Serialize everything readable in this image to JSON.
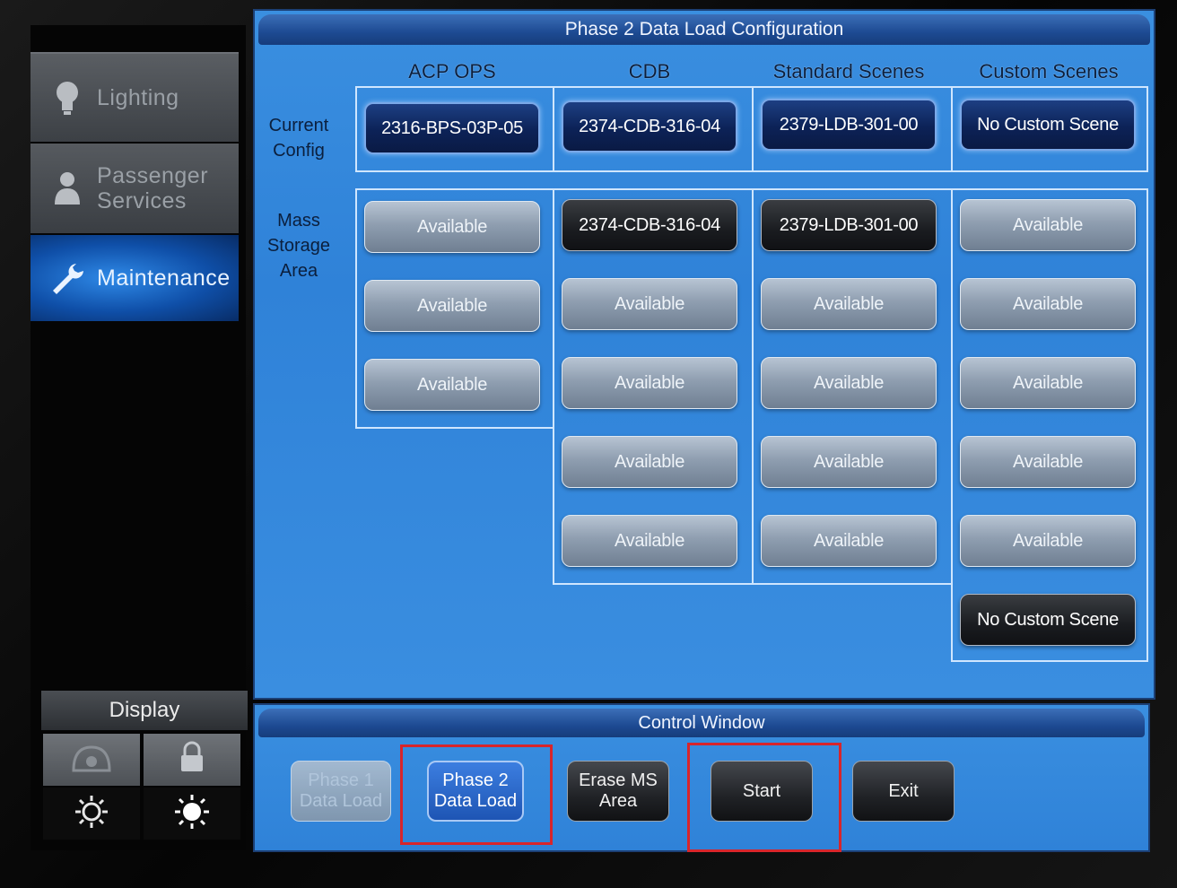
{
  "sidebar": {
    "items": [
      {
        "label": "Lighting"
      },
      {
        "label": "Passenger Services"
      },
      {
        "label": "Maintenance"
      }
    ],
    "display_label": "Display"
  },
  "main": {
    "title": "Phase 2 Data Load Configuration",
    "columns": [
      "ACP OPS",
      "CDB",
      "Standard Scenes",
      "Custom Scenes"
    ],
    "row_labels": {
      "current_config": "Current Config",
      "mass_storage": "Mass Storage Area"
    },
    "current_config": [
      "2316-BPS-03P-05",
      "2374-CDB-316-04",
      "2379-LDB-301-00",
      "No Custom Scene"
    ],
    "mass_storage": {
      "acp_ops": [
        "Available",
        "Available",
        "Available"
      ],
      "cdb": [
        "2374-CDB-316-04",
        "Available",
        "Available",
        "Available",
        "Available"
      ],
      "standard_scenes": [
        "2379-LDB-301-00",
        "Available",
        "Available",
        "Available",
        "Available"
      ],
      "custom_scenes": [
        "Available",
        "Available",
        "Available",
        "Available",
        "Available",
        "No Custom Scene"
      ]
    }
  },
  "control_window": {
    "title": "Control Window",
    "buttons": {
      "phase1": "Phase 1 Data Load",
      "phase2": "Phase 2 Data Load",
      "erase": "Erase MS Area",
      "start": "Start",
      "exit": "Exit"
    }
  },
  "colors": {
    "panel_blue": "#2f82d8",
    "title_bar": "#1d4a92",
    "highlight_red": "#d8252b"
  }
}
